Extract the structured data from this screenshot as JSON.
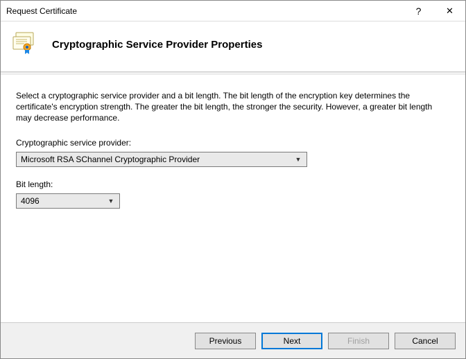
{
  "window": {
    "title": "Request Certificate",
    "help_symbol": "?",
    "close_symbol": "✕"
  },
  "header": {
    "title": "Cryptographic Service Provider Properties"
  },
  "content": {
    "description": "Select a cryptographic service provider and a bit length. The bit length of the encryption key determines the certificate's encryption strength. The greater the bit length, the stronger the security. However, a greater bit length may decrease performance.",
    "provider_label": "Cryptographic service provider:",
    "provider_value": "Microsoft RSA SChannel Cryptographic Provider",
    "bitlength_label": "Bit length:",
    "bitlength_value": "4096"
  },
  "buttons": {
    "previous": "Previous",
    "next": "Next",
    "finish": "Finish",
    "cancel": "Cancel"
  }
}
